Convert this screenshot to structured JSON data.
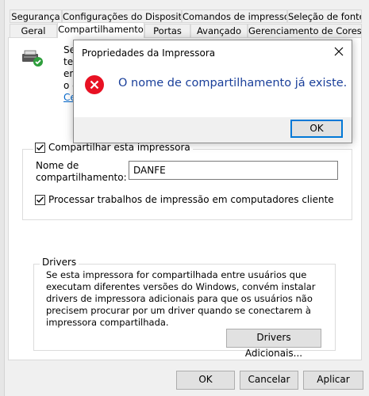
{
  "tabs_row1": [
    "Segurança",
    "Configurações do Dispositivo",
    "Comandos de impressora",
    "Seleção de fonte"
  ],
  "tabs_row2": [
    "Geral",
    "Compartilhamento",
    "Portas",
    "Avançado",
    "Gerenciamento de Cores"
  ],
  "active_tab": "Compartilhamento",
  "partial_text": [
    "Se",
    "te",
    "en",
    "o c"
  ],
  "partial_link": "Ce",
  "share": {
    "checkbox_label": "Compartilhar esta impressora",
    "checked": true,
    "name_label": "Nome de compartilhamento:",
    "name_value": "DANFE",
    "process_label": "Processar trabalhos de impressão em computadores cliente",
    "process_checked": true
  },
  "drivers": {
    "legend": "Drivers",
    "text": "Se esta impressora for compartilhada entre usuários que executam diferentes versões do Windows, convém instalar drivers de impressora adicionais para que os usuários não precisem procurar por um driver quando se conectarem à impressora compartilhada.",
    "button": "Drivers Adicionais..."
  },
  "footer": {
    "ok": "OK",
    "cancel": "Cancelar",
    "apply": "Aplicar"
  },
  "dialog": {
    "title": "Propriedades da Impressora",
    "message": "O nome de compartilhamento já existe.",
    "ok": "OK",
    "icon": "error-icon"
  },
  "colors": {
    "accent": "#0078d7",
    "error": "#e81123",
    "message": "#1a3f9a",
    "link": "#0066cc"
  }
}
